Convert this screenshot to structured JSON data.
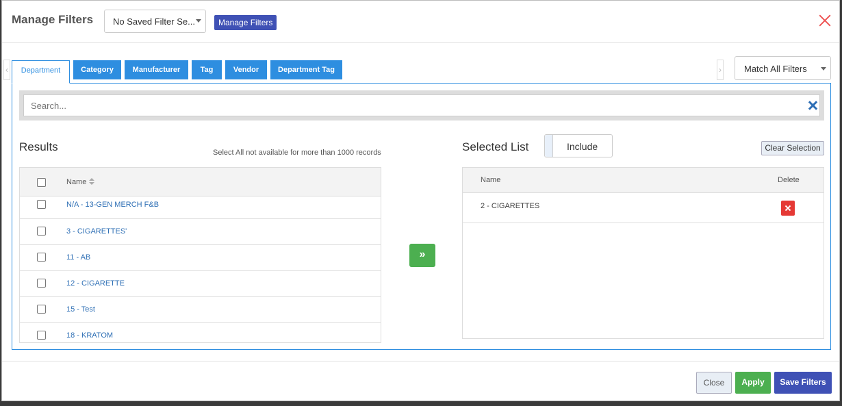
{
  "header": {
    "title": "Manage Filters",
    "saved_filter_value": "No Saved Filter Se...",
    "manage_filters_button": "Manage Filters"
  },
  "tabs": [
    {
      "label": "Department",
      "active": true
    },
    {
      "label": "Category"
    },
    {
      "label": "Manufacturer"
    },
    {
      "label": "Tag"
    },
    {
      "label": "Vendor"
    },
    {
      "label": "Department Tag"
    }
  ],
  "match_select": {
    "value": "Match All Filters"
  },
  "search": {
    "placeholder": "Search..."
  },
  "results": {
    "title": "Results",
    "note": "Select All not available for more than 1000 records",
    "column_name": "Name",
    "rows": [
      "N/A - 13-GEN MERCH F&B",
      "3 - CIGARETTES'",
      "11 - AB",
      "12 - CIGARETTE",
      "15 - Test",
      "18 - KRATOM"
    ]
  },
  "selected": {
    "title": "Selected List",
    "toggle_label": "Include",
    "clear_button": "Clear Selection",
    "column_name": "Name",
    "column_delete": "Delete",
    "rows": [
      "2 - CIGARETTES"
    ]
  },
  "footer": {
    "close": "Close",
    "apply": "Apply",
    "save": "Save Filters"
  },
  "colors": {
    "accent_blue": "#2e8ee0",
    "indigo": "#3f51b5",
    "green": "#4caf50",
    "red": "#e53935"
  }
}
